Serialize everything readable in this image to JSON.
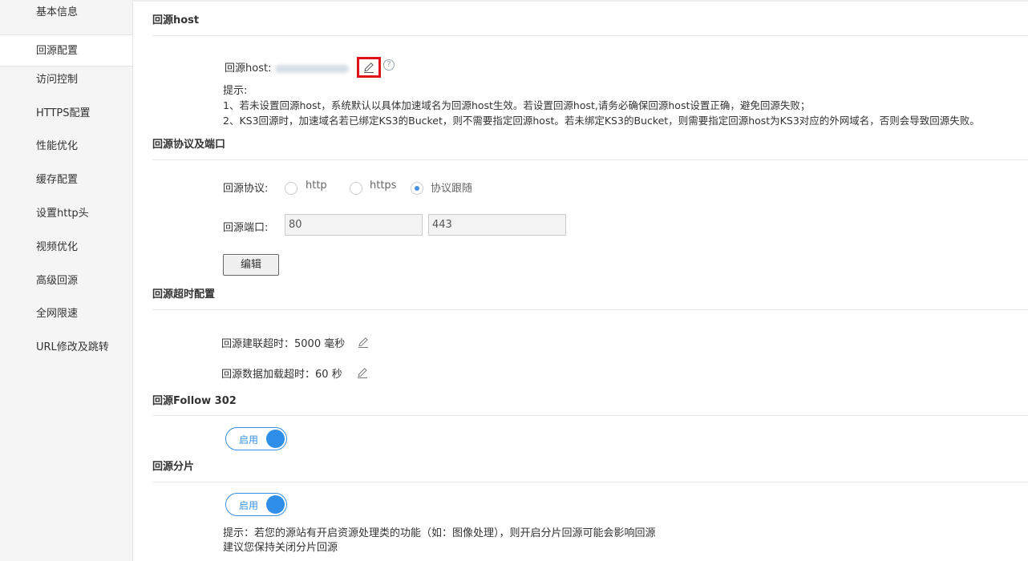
{
  "sidebar": {
    "items": [
      {
        "label": "基本信息",
        "active": false
      },
      {
        "label": "回源配置",
        "active": true
      },
      {
        "label": "访问控制",
        "active": false
      },
      {
        "label": "HTTPS配置",
        "active": false
      },
      {
        "label": "性能优化",
        "active": false
      },
      {
        "label": "缓存配置",
        "active": false
      },
      {
        "label": "设置http头",
        "active": false
      },
      {
        "label": "视频优化",
        "active": false
      },
      {
        "label": "高级回源",
        "active": false
      },
      {
        "label": "全网限速",
        "active": false
      },
      {
        "label": "URL修改及跳转",
        "active": false
      }
    ]
  },
  "origin_host": {
    "title": "回源host",
    "label": "回源host:",
    "tips_title": "提示:",
    "tip1": "1、若未设置回源host，系统默认以具体加速域名为回源host生效。若设置回源host,请务必确保回源host设置正确，避免回源失败；",
    "tip2": "2、KS3回源时，加速域名若已绑定KS3的Bucket，则不需要指定回源host。若未绑定KS3的Bucket，则需要指定回源host为KS3对应的外网域名，否则会导致回源失败。"
  },
  "protocol_port": {
    "title": "回源协议及端口",
    "protocol_label": "回源协议:",
    "options": [
      "http",
      "https",
      "协议跟随"
    ],
    "selected": "协议跟随",
    "port_label": "回源端口:",
    "port_http": "80",
    "port_https": "443",
    "edit_button": "编辑"
  },
  "timeout": {
    "title": "回源超时配置",
    "connect_label": "回源建联超时：",
    "connect_value": "5000",
    "connect_unit": "毫秒",
    "load_label": "回源数据加载超时：",
    "load_value": "60",
    "load_unit": "秒"
  },
  "follow302": {
    "title": "回源Follow 302",
    "toggle_label": "启用",
    "enabled": true
  },
  "range": {
    "title": "回源分片",
    "toggle_label": "启用",
    "enabled": true,
    "tip1": "提示：若您的源站有开启资源处理类的功能（如：图像处理），则开启分片回源可能会影响回源",
    "tip2": "建议您保持关闭分片回源"
  },
  "colors": {
    "accent": "#2f8fe8",
    "highlight_box": "#e0111b"
  }
}
